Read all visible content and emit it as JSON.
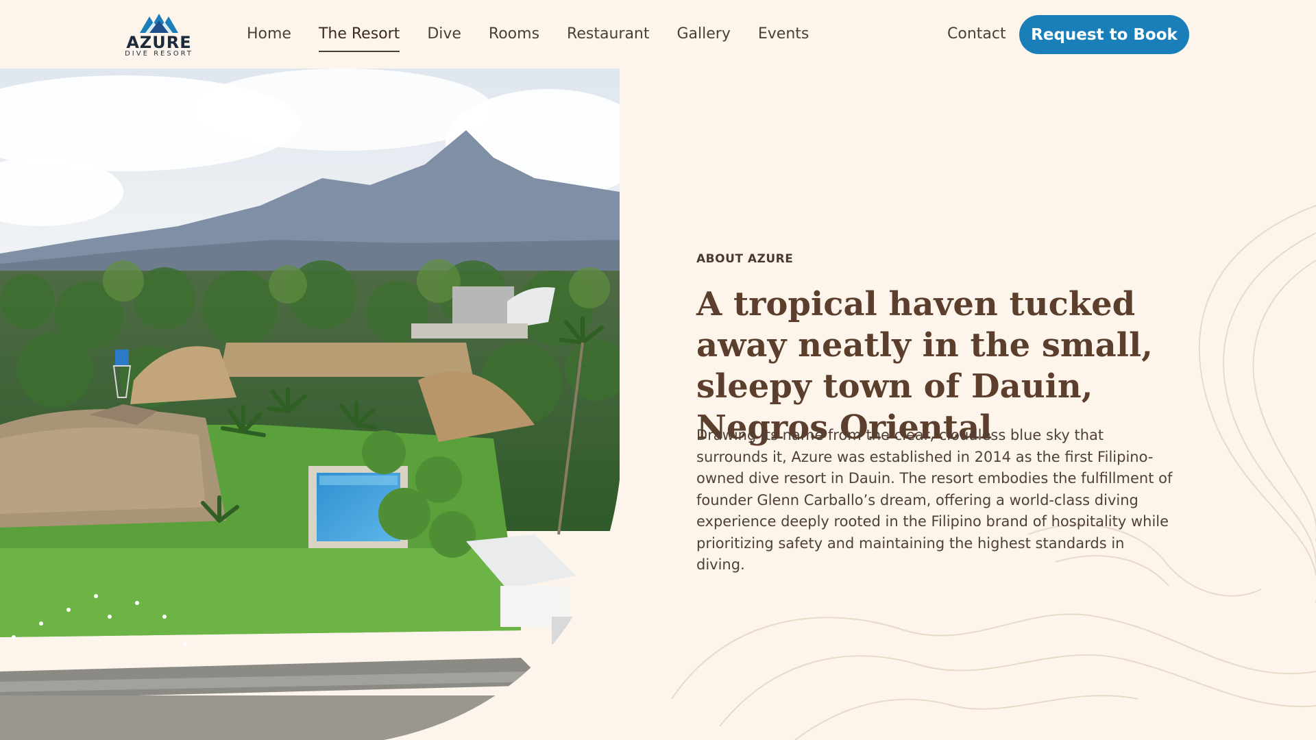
{
  "brand": {
    "logo_word": "AZURE",
    "logo_sub": "DIVE RESORT",
    "accent": "#1a7fb8",
    "heading_color": "#5b3e2b",
    "background": "#fdf5ec"
  },
  "nav": {
    "items": [
      {
        "label": "Home"
      },
      {
        "label": "The Resort"
      },
      {
        "label": "Dive"
      },
      {
        "label": "Rooms"
      },
      {
        "label": "Restaurant"
      },
      {
        "label": "Gallery"
      },
      {
        "label": "Events"
      }
    ],
    "active": "The Resort",
    "contact_label": "Contact",
    "cta_label": "Request to Book"
  },
  "hero": {
    "image": "aerial-resort-photo",
    "icons": [
      "mountain-logo-icon"
    ]
  },
  "about": {
    "eyebrow": "ABOUT AZURE",
    "headline": "A tropical haven tucked away neatly in the small, sleepy town of Dauin, Negros Oriental",
    "body": "Drawing its name from the clear, cloudless blue sky that surrounds it, Azure was established in 2014 as the first Filipino-owned dive resort in Dauin. The resort embodies the fulfillment of founder Glenn Carballo’s dream, offering a world-class diving experience deeply rooted in the Filipino brand of hospitality while prioritizing safety and maintaining the highest standards in diving."
  }
}
